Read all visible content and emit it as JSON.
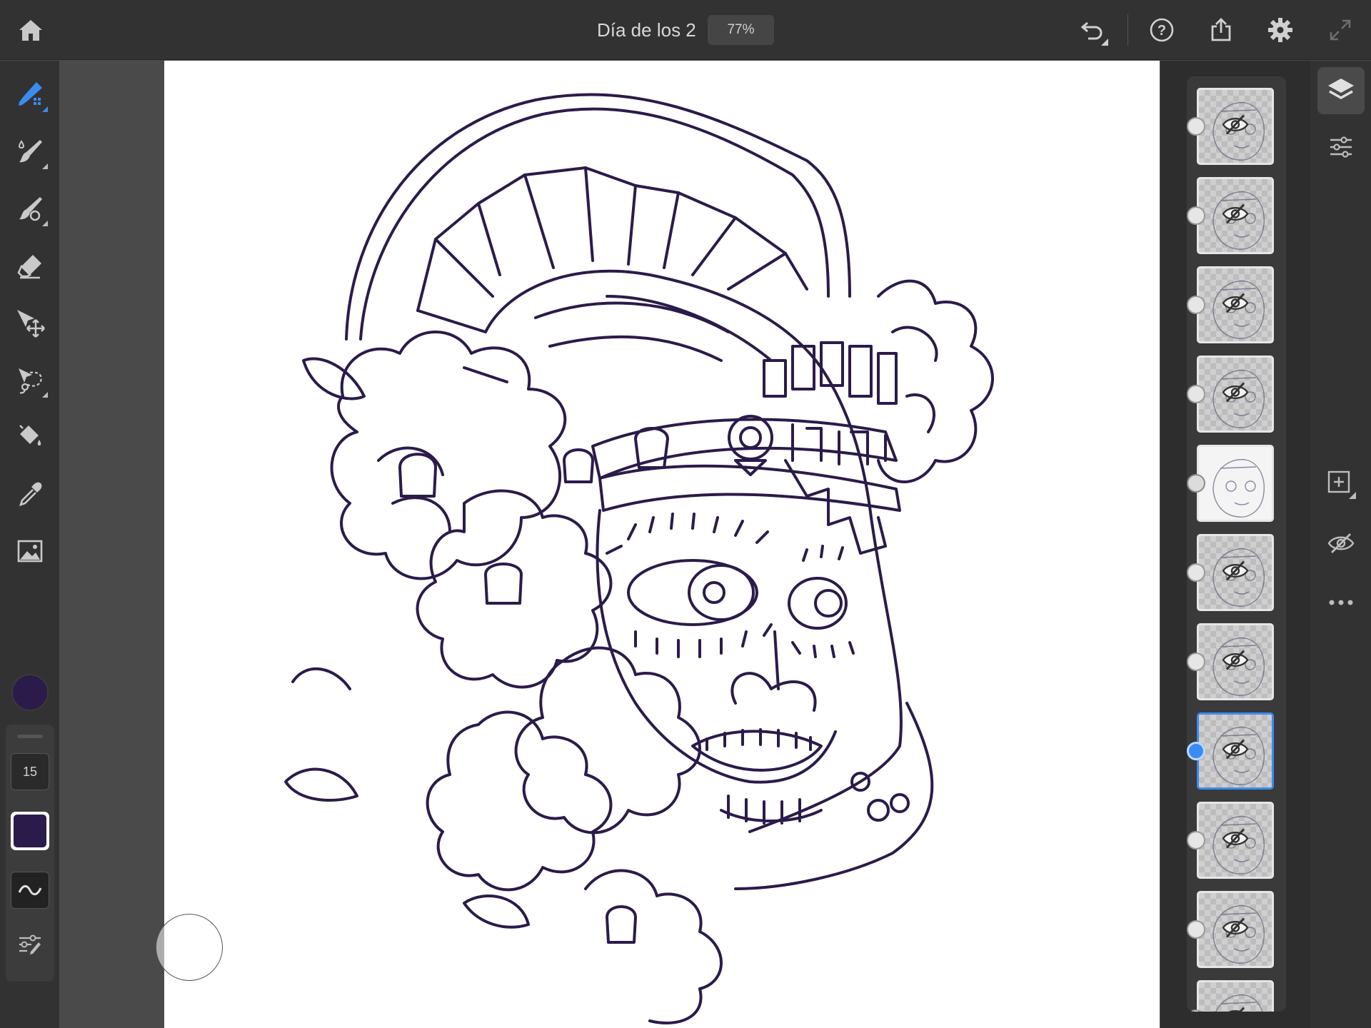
{
  "app": {
    "document_title": "Día de los 2",
    "zoom_level": "77%"
  },
  "toolbar": {
    "brush_size": "15",
    "current_color": "#2b1b4a",
    "accent_color": "#3b8cf0"
  },
  "tools": [
    {
      "name": "pixel-brush",
      "icon": "pixel-brush-icon",
      "active": true
    },
    {
      "name": "live-brush",
      "icon": "live-brush-icon"
    },
    {
      "name": "vector-brush",
      "icon": "vector-brush-icon"
    },
    {
      "name": "eraser",
      "icon": "eraser-icon"
    },
    {
      "name": "transform",
      "icon": "move-transform-icon"
    },
    {
      "name": "selection",
      "icon": "lasso-select-icon"
    },
    {
      "name": "fill",
      "icon": "paint-bucket-icon"
    },
    {
      "name": "eyedropper",
      "icon": "eyedropper-icon"
    },
    {
      "name": "image",
      "icon": "image-icon"
    }
  ],
  "layers": [
    {
      "visible": false,
      "selected": false
    },
    {
      "visible": false,
      "selected": false
    },
    {
      "visible": false,
      "selected": false
    },
    {
      "visible": false,
      "selected": false
    },
    {
      "visible": true,
      "selected": false
    },
    {
      "visible": false,
      "selected": false
    },
    {
      "visible": false,
      "selected": false
    },
    {
      "visible": false,
      "selected": true
    },
    {
      "visible": false,
      "selected": false
    },
    {
      "visible": false,
      "selected": false
    },
    {
      "visible": false,
      "selected": false
    }
  ]
}
